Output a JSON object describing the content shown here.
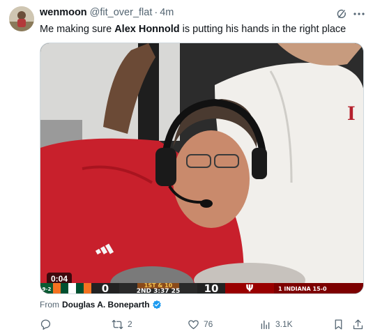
{
  "tweet": {
    "display_name": "wenmoon",
    "handle": "@fit_over_flat",
    "separator": "·",
    "time": "4m",
    "text_before": "Me making sure ",
    "text_bold": "Alex Honnold",
    "text_after": " is putting his hands in the right place"
  },
  "media": {
    "video_time": "0:04",
    "scoreboard": {
      "left_record": "9-2",
      "away_score": "0",
      "down_distance": "1ST & 10",
      "clock": "2ND  3:37  25",
      "home_score": "10",
      "home_name": "1 INDIANA 15-0"
    }
  },
  "attribution": {
    "prefix": "From",
    "source": "Douglas A. Boneparth"
  },
  "actions": {
    "reply_count": "",
    "retweet_count": "2",
    "like_count": "76",
    "views_count": "3.1K"
  },
  "colors": {
    "verified": "#1d9bf0",
    "muted": "#536471",
    "text": "#0f1419"
  },
  "icons": [
    "grok-icon",
    "more-icon",
    "verified-icon",
    "reply-icon",
    "retweet-icon",
    "like-icon",
    "views-icon",
    "bookmark-icon",
    "share-icon"
  ]
}
